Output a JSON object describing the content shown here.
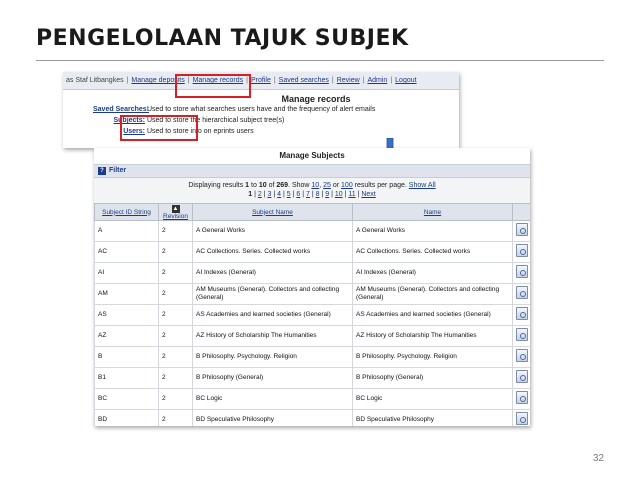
{
  "slide": {
    "title": "PENGELOLAAN TAJUK SUBJEK",
    "page_number": "32"
  },
  "admin_screen": {
    "nav": [
      "as Staf Litbangkes",
      "Manage deposits",
      "Manage records",
      "Profile",
      "Saved searches",
      "Review",
      "Admin",
      "Logout"
    ],
    "title": "Manage records",
    "rows": [
      {
        "label": "Saved Searches:",
        "text": "Used to store what searches users have and the frequency of alert emails"
      },
      {
        "label": "Subjects:",
        "text": "Used to store the hierarchical subject tree(s)"
      },
      {
        "label": "Users:",
        "text": "Used to store info on eprints users"
      }
    ]
  },
  "subjects_screen": {
    "title": "Manage Subjects",
    "filter_label": "Filter",
    "pager": {
      "summary_prefix": "Displaying results",
      "current": "1",
      "to": "to",
      "ten": "10",
      "of": "of",
      "total": "269",
      "show": "Show",
      "opt10": "10",
      "opt25": "25",
      "or": "or",
      "opt100": "100",
      "per_page": "results per page.",
      "show_all": "Show All",
      "pages": [
        "2",
        "3",
        "4",
        "5",
        "6",
        "7",
        "8",
        "9",
        "10",
        "11"
      ],
      "next": "Next"
    },
    "columns": [
      "Subject ID String",
      "Revision",
      "Subject Name",
      "Name"
    ],
    "rows": [
      {
        "id": "A",
        "rev": "2",
        "subject": "A General Works",
        "name": "A General Works"
      },
      {
        "id": "AC",
        "rev": "2",
        "subject": "AC Collections. Series. Collected works",
        "name": "AC Collections. Series. Collected works"
      },
      {
        "id": "AI",
        "rev": "2",
        "subject": "AI Indexes (General)",
        "name": "AI Indexes (General)"
      },
      {
        "id": "AM",
        "rev": "2",
        "subject": "AM Museums (General). Collectors and collecting (General)",
        "name": "AM Museums (General). Collectors and collecting (General)"
      },
      {
        "id": "AS",
        "rev": "2",
        "subject": "AS Academies and learned societies (General)",
        "name": "AS Academies and learned societies (General)"
      },
      {
        "id": "AZ",
        "rev": "2",
        "subject": "AZ History of Scholarship The Humanities",
        "name": "AZ History of Scholarship The Humanities"
      },
      {
        "id": "B",
        "rev": "2",
        "subject": "B Philosophy. Psychology. Religion",
        "name": "B Philosophy. Psychology. Religion"
      },
      {
        "id": "B1",
        "rev": "2",
        "subject": "B Philosophy (General)",
        "name": "B Philosophy (General)"
      },
      {
        "id": "BC",
        "rev": "2",
        "subject": "BC Logic",
        "name": "BC Logic"
      },
      {
        "id": "BD",
        "rev": "2",
        "subject": "BD Speculative Philosophy",
        "name": "BD Speculative Philosophy"
      }
    ]
  }
}
